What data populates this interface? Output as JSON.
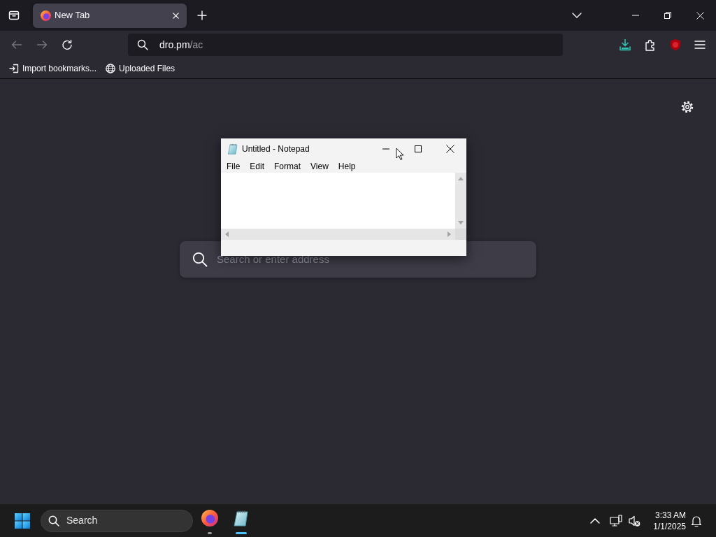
{
  "browser": {
    "tabs": [
      {
        "title": "New Tab",
        "selected": true
      }
    ],
    "address_bar": {
      "host": "dro.pm",
      "path": "/ac"
    },
    "bookmarks": [
      {
        "kind": "import",
        "label": "Import bookmarks..."
      },
      {
        "kind": "globe",
        "label": "Uploaded Files"
      }
    ],
    "new_tab_search": {
      "placeholder": "Search or enter address"
    }
  },
  "notepad": {
    "title": "Untitled - Notepad",
    "menu": [
      "File",
      "Edit",
      "Format",
      "View",
      "Help"
    ]
  },
  "taskbar": {
    "search": {
      "placeholder": "Search"
    },
    "apps": [
      {
        "kind": "browser",
        "selected": false
      },
      {
        "kind": "notepad",
        "selected": true
      }
    ],
    "clock": {
      "time": "3:33 AM",
      "date": "1/1/2025"
    }
  }
}
